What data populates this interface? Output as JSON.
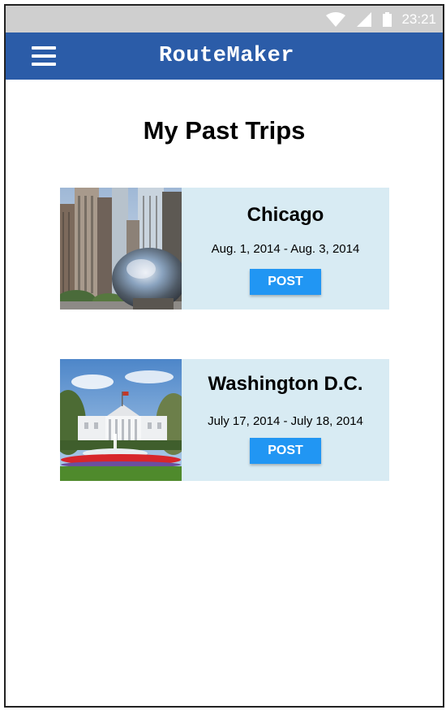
{
  "status_bar": {
    "time": "23:21",
    "icons": [
      "wifi-icon",
      "signal-icon",
      "battery-icon"
    ]
  },
  "app_bar": {
    "title": "RouteMaker",
    "menu_icon": "hamburger-menu-icon",
    "color": "#2b5ca8"
  },
  "page": {
    "title": "My Past Trips"
  },
  "trips": [
    {
      "name": "Chicago",
      "dates": "Aug. 1, 2014 - Aug. 3, 2014",
      "button_label": "POST",
      "photo": "chicago-bean-skyline-photo"
    },
    {
      "name": "Washington D.C.",
      "dates": "July 17, 2014 - July 18, 2014",
      "button_label": "POST",
      "photo": "white-house-photo"
    }
  ],
  "colors": {
    "card_bg": "#d8ebf3",
    "button": "#2196f3"
  }
}
